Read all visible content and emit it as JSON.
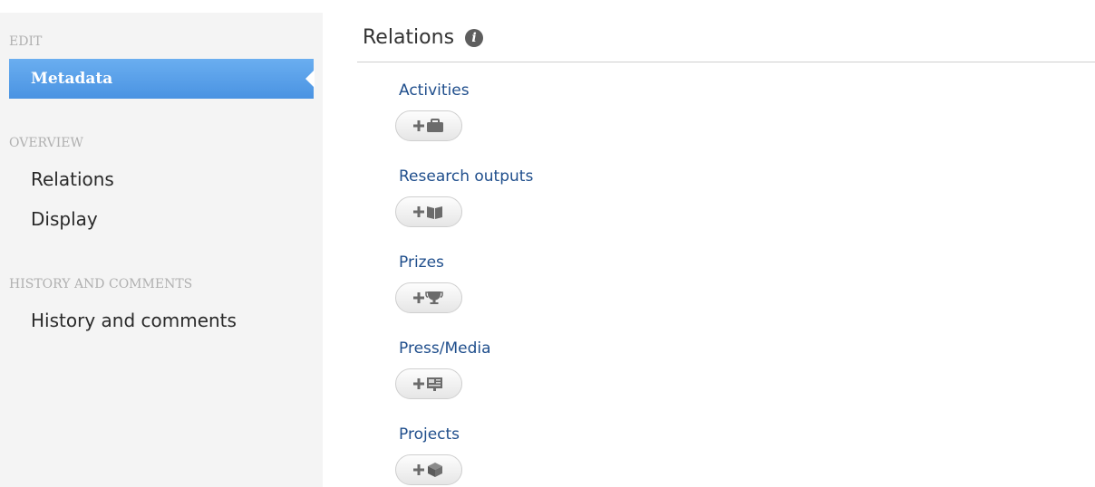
{
  "sidebar": {
    "edit_heading": "EDIT",
    "metadata_label": "Metadata",
    "overview_heading": "OVERVIEW",
    "relations_label": "Relations",
    "display_label": "Display",
    "history_heading": "HISTORY AND COMMENTS",
    "history_label": "History and comments"
  },
  "main": {
    "title": "Relations",
    "info_icon": "info-icon",
    "relations": [
      {
        "label": "Activities",
        "icon": "briefcase-icon"
      },
      {
        "label": "Research outputs",
        "icon": "book-icon"
      },
      {
        "label": "Prizes",
        "icon": "trophy-icon"
      },
      {
        "label": "Press/Media",
        "icon": "newspaper-icon"
      },
      {
        "label": "Projects",
        "icon": "cube-icon"
      }
    ]
  },
  "colors": {
    "active_nav": "#4a93e2",
    "link": "#1f4e8c",
    "sidebar_bg": "#f4f4f4"
  }
}
